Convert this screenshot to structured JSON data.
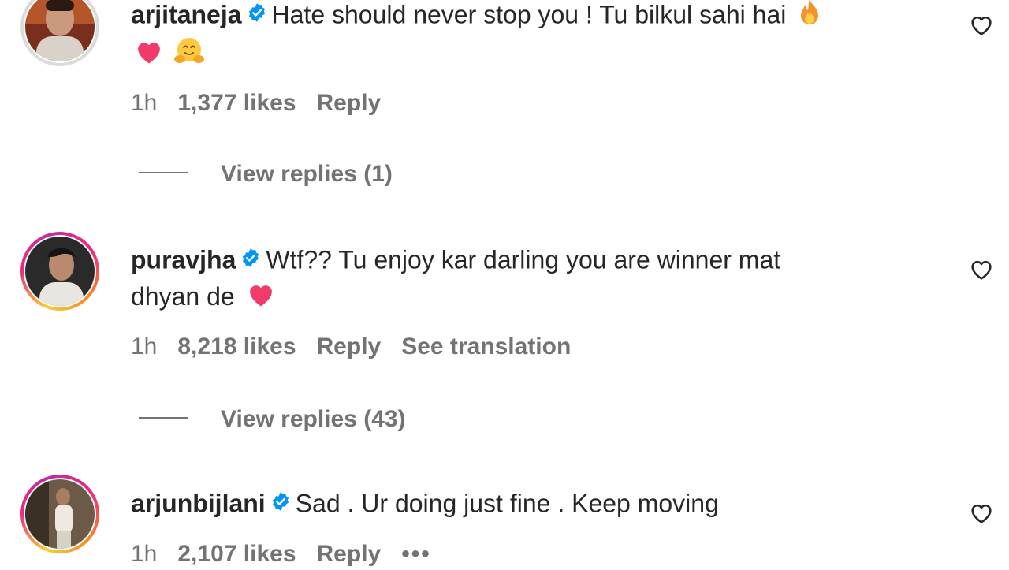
{
  "comments": [
    {
      "username": "arjitaneja",
      "text_line1": "Hate should never stop you ! Tu bilkul sahi hai",
      "text_line2": "",
      "time": "1h",
      "likes": "1,377 likes",
      "reply": "Reply",
      "extra": "",
      "view_replies": "View replies (1)",
      "icons": [
        "verified-badge",
        "fire-emoji",
        "heart-emoji",
        "hugging-face-emoji",
        "heart-outline-icon"
      ]
    },
    {
      "username": "puravjha",
      "text_line1": "Wtf?? Tu enjoy kar darling you are winner mat",
      "text_line2": "dhyan de",
      "time": "1h",
      "likes": "8,218 likes",
      "reply": "Reply",
      "extra": "See translation",
      "view_replies": "View replies (43)",
      "icons": [
        "verified-badge",
        "heart-emoji",
        "heart-outline-icon"
      ]
    },
    {
      "username": "arjunbijlani",
      "text_line1": "Sad . Ur doing just fine . Keep moving",
      "text_line2": "",
      "time": "1h",
      "likes": "2,107 likes",
      "reply": "Reply",
      "extra": "•••",
      "view_replies": "",
      "icons": [
        "verified-badge",
        "more-options-icon",
        "heart-outline-icon"
      ]
    }
  ],
  "colors": {
    "text": "#262626",
    "secondary": "#737373",
    "verified": "#0095f6",
    "heart_emoji": "#f23a6b"
  }
}
